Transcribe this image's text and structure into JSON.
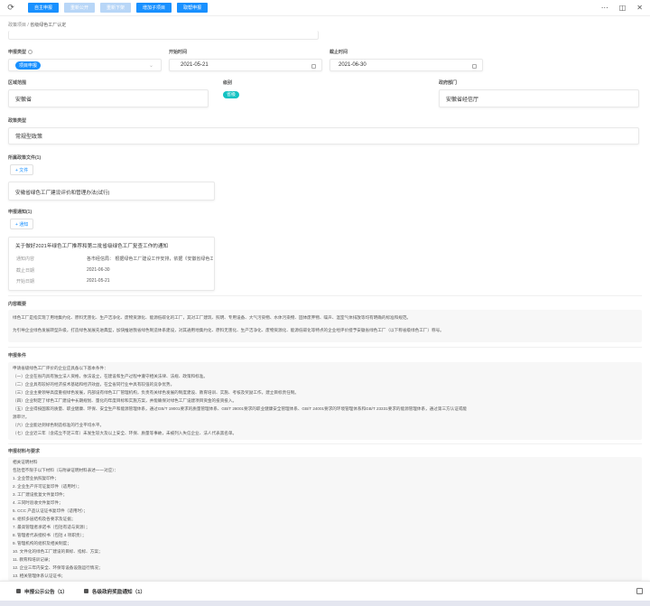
{
  "toolbar": {
    "buttons": [
      {
        "label": "自主申报",
        "state": "primary"
      },
      {
        "label": "重新公开",
        "state": "disabled"
      },
      {
        "label": "重新下架",
        "state": "disabled"
      },
      {
        "label": "增加子项目",
        "state": "primary"
      },
      {
        "label": "取帮申报",
        "state": "primary"
      }
    ]
  },
  "breadcrumb": {
    "parent": "政策项目",
    "separator": " / ",
    "current": "省级绿色工厂认定"
  },
  "form": {
    "apply_type_label": "申报类型",
    "apply_type_value": "项目申报",
    "start_label": "开始时间",
    "start_value": "2021-05-21",
    "end_label": "截止时间",
    "end_value": "2021-06-30",
    "region_label": "区域范围",
    "region_value": "安徽省",
    "level_label": "级别",
    "level_value": "省级",
    "dept_label": "政府部门",
    "dept_value": "安徽省经信厅",
    "policy_type_label": "政策类型",
    "policy_type_value": "常规型政策"
  },
  "files": {
    "label": "所属政策文件(1)",
    "add_label": "+ 文件",
    "items": [
      "安徽省绿色工厂建设评价和管理办法(试行)"
    ]
  },
  "notices": {
    "label": "申报通知(1)",
    "add_label": "+ 通知",
    "title": "关于做好2021年绿色工厂推荐和第二批省级绿色工厂复查工作的通知",
    "rows": [
      {
        "k": "通知内容",
        "v": "各市经信局：  根据绿色工厂建设工作安排，依据《安徽省绿色工厂"
      },
      {
        "k": "截止日期",
        "v": "2021-06-30"
      },
      {
        "k": "开始日期",
        "v": "2021-05-21"
      }
    ]
  },
  "summary": {
    "label": "内容概要",
    "lines": [
      "绿色工厂是指实现了用地集约化、原料无害化、生产洁净化、废物资源化、能源低碳化的工厂，其对工厂建筑、照明、专用设备、大气污染物、水体污染物、固体废弃物、噪声、温室气体排放等均有明确的标准和规范。",
      "为引导企业绿色发展转型升级，打造绿色发展先进典型，加快推进我省绿色制造体系建设，对其通用地集约化、原料无害化、生产洁净化、废物资源化、能源低碳化等特点的企业经评价授予安徽省绿色工厂（以下称省级绿色工厂）称号。"
    ]
  },
  "conditions": {
    "label": "申报条件",
    "lines": [
      "申请省级绿色工厂评价的企业应具备以下基本条件：",
      "（一）企业在省内具有独立法人资格，依法设立，在建设和生产过程中遵守相关法律、法规、政策和标准。",
      "（二）企业具有较好的经济技术基础和经济效益，在全省同行业中具有较强的竞争优势。",
      "（三）企业主要领导高度重视绿色发展，内部设有绿色工厂管理机构，负责有关绿色发展的制度建设、教育培训、实施、考核及奖励工作，建立目标责任制。",
      "（四）企业制定了绿色工厂建设中长期规划、量化的年度目标和实施方案，并能确保对绿色工厂设建项目资金的投资投入。",
      "（五）企业得按国家的质量、职业健康、环保、安全生产和能源管理体系，通过GB/T 19001要求的质量管理体系、GB/T 28001要求的职业健康安全管理体系、GB/T 24001要求的环境管理体系和GB/T 23331要求的能源管理体系，通过第三方认证或能",
      "源审计。",
      "（六）企业能达到绿色制造标准的行业平均水平。",
      "（七）企业近三年（含成立不足三年）未发生较大及以上安全、环保、质量等事故，未被列入失信企业、法人代表黑名单。"
    ]
  },
  "materials": {
    "label": "申报材料与要求",
    "lines": [
      "相关证明材料",
      "包括但不限于以下材料（与附录证明材料表述一一对应）：",
      "1. 企业营业执照复印件；",
      "2. 企业生产许可证复印件（适用时）；",
      "3. 工厂建设批复文件复印件；",
      "4. 三同时验收文件复印件；",
      "5. CCC 产品认证证书复印件（适用时）；",
      "6. 组织多层结构及各要求及证据；",
      "7. 最高管理者承诺书（包括有适与资源）；",
      "8. 管理者代表授权书（包括 4 项职责）；",
      "9. 管理机构的组织及相关制度；",
      "10. 文件化的绿色工厂建设的目标、指标、方案；",
      "11. 教育和培训记录；",
      "12. 企业三年内安全、环保等设备设施运行情况；",
      "13. 相关管理体系认证证书；"
    ]
  },
  "bottom": {
    "items": [
      "申报公示公告（1）",
      "各级政府奖励通知（1）"
    ]
  }
}
